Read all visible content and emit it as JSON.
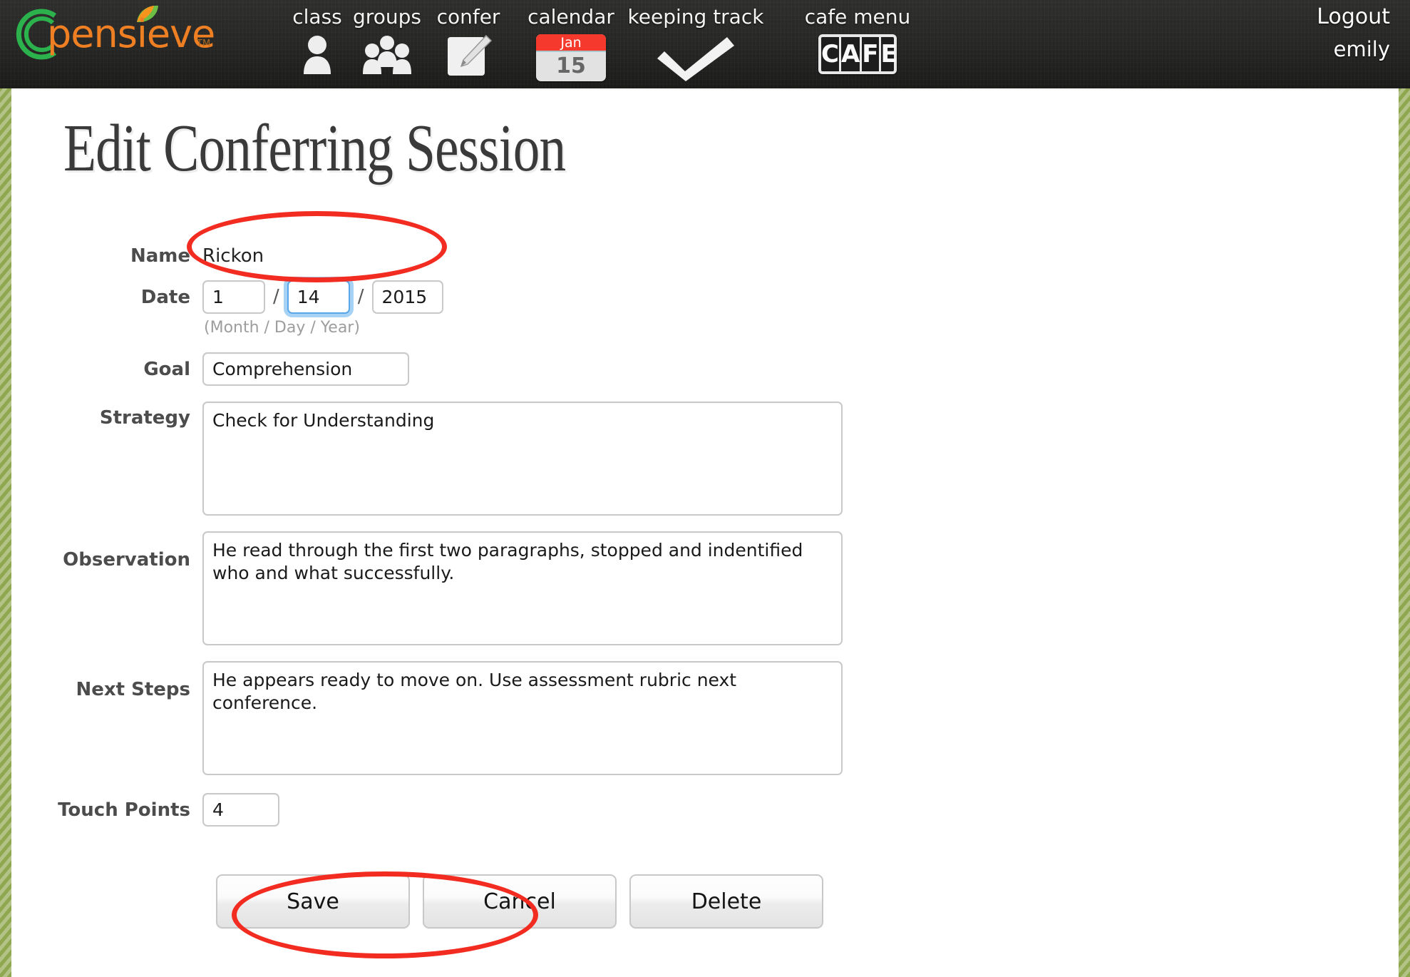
{
  "brand": {
    "name": "pensieve",
    "trademark": "TM",
    "logo_color": "#ef7f23",
    "ring_color": "#2bb24c",
    "leaf_colors": [
      "#f7941e",
      "#6cbe45"
    ]
  },
  "nav": {
    "items": [
      {
        "label": "class",
        "icon": "person-icon"
      },
      {
        "label": "groups",
        "icon": "people-group-icon"
      },
      {
        "label": "confer",
        "icon": "note-pencil-icon"
      },
      {
        "label": "calendar",
        "icon": "calendar-icon",
        "calendar_month": "Jan",
        "calendar_day": "15"
      },
      {
        "label": "keeping track",
        "icon": "checkmark-icon"
      },
      {
        "label": "cafe menu",
        "icon": "cafe-icon",
        "cafe_letters": [
          "C",
          "A",
          "F",
          "E"
        ]
      }
    ]
  },
  "account": {
    "logout_label": "Logout",
    "username": "emily"
  },
  "page": {
    "title": "Edit Conferring Session"
  },
  "form": {
    "name": {
      "label": "Name",
      "value": "Rickon"
    },
    "date": {
      "label": "Date",
      "month": "1",
      "day": "14",
      "year": "2015",
      "separator": "/",
      "hint": "(Month / Day / Year)",
      "focused_field": "day"
    },
    "goal": {
      "label": "Goal",
      "value": "Comprehension"
    },
    "strategy": {
      "label": "Strategy",
      "value": "Check for Understanding"
    },
    "observation": {
      "label": "Observation",
      "value": "He read through the first two paragraphs, stopped and indentified who and what successfully."
    },
    "next_steps": {
      "label": "Next Steps",
      "value": "He appears ready to move on. Use assessment rubric next conference."
    },
    "touch_points": {
      "label": "Touch Points",
      "value": "4"
    }
  },
  "buttons": {
    "save": "Save",
    "cancel": "Cancel",
    "delete": "Delete"
  },
  "annotations": {
    "color": "#f32c22",
    "highlights": [
      "date-fields",
      "save-button"
    ]
  },
  "theme": {
    "edge_stripe_green": "#8fa74e",
    "navbar_dark": "#262626",
    "focus_blue": "#5aa7e8"
  }
}
